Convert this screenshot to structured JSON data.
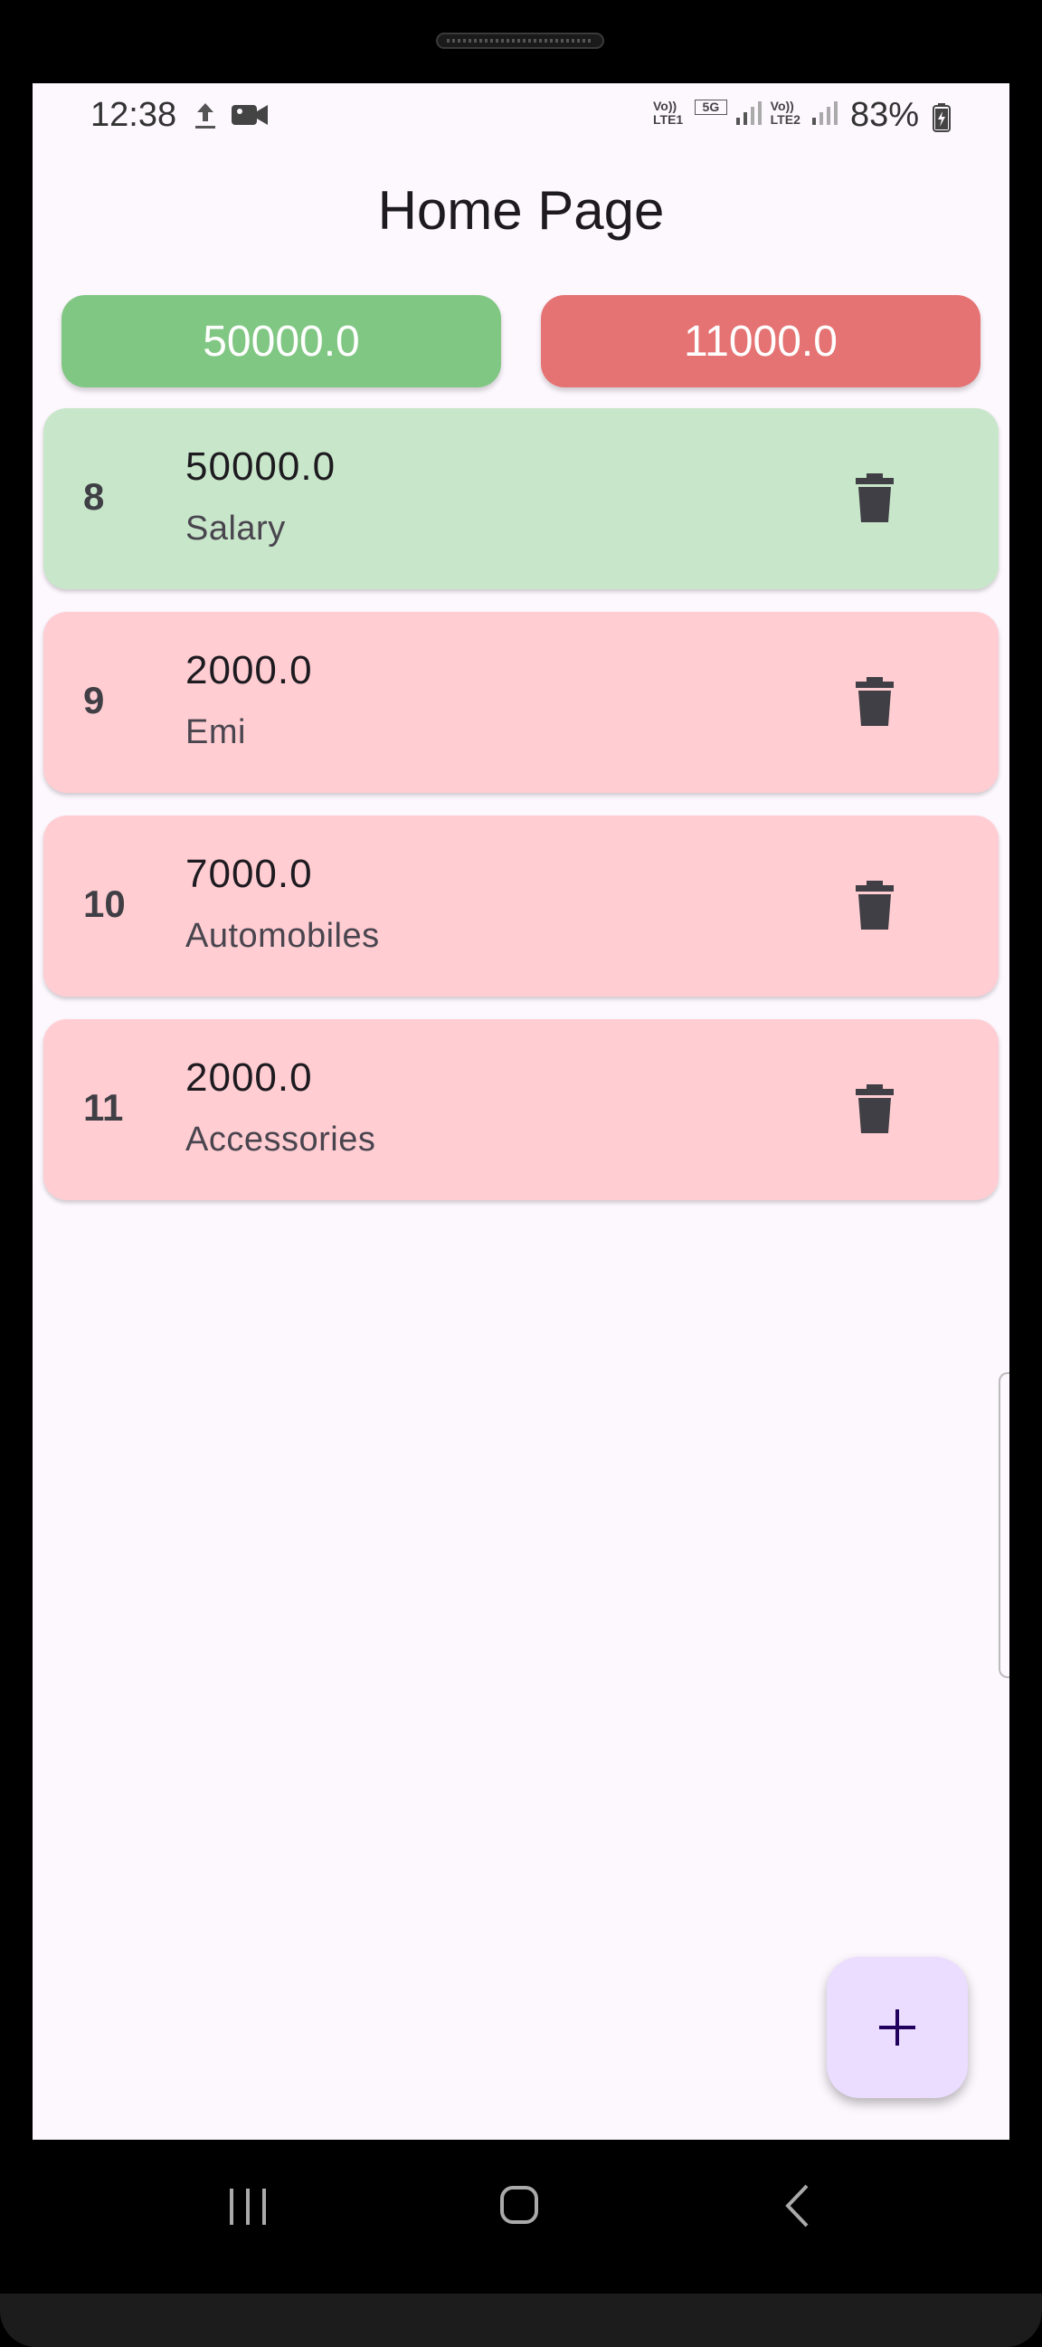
{
  "status_bar": {
    "time": "12:38",
    "network_sim1": "Vo)) LTE1",
    "network_5g": "5G",
    "network_sim2": "Vo)) LTE2",
    "battery": "83%"
  },
  "header": {
    "title": "Home Page"
  },
  "totals": {
    "income": "50000.0",
    "expense": "11000.0",
    "income_color": "#81c784",
    "expense_color": "#e57373"
  },
  "transactions": [
    {
      "id": "8",
      "amount": "50000.0",
      "category": "Salary",
      "type": "income",
      "color": "#c8e6c9"
    },
    {
      "id": "9",
      "amount": "2000.0",
      "category": "Emi",
      "type": "expense",
      "color": "#ffcdd2"
    },
    {
      "id": "10",
      "amount": "7000.0",
      "category": "Automobiles",
      "type": "expense",
      "color": "#ffcdd2"
    },
    {
      "id": "11",
      "amount": "2000.0",
      "category": "Accessories",
      "type": "expense",
      "color": "#ffcdd2"
    }
  ],
  "icons": {
    "delete": "trash-icon",
    "add": "plus-icon",
    "nav_recents": "recents-icon",
    "nav_home": "home-icon",
    "nav_back": "back-icon"
  },
  "fab": {
    "symbol": "+",
    "color": "#eaddff"
  }
}
